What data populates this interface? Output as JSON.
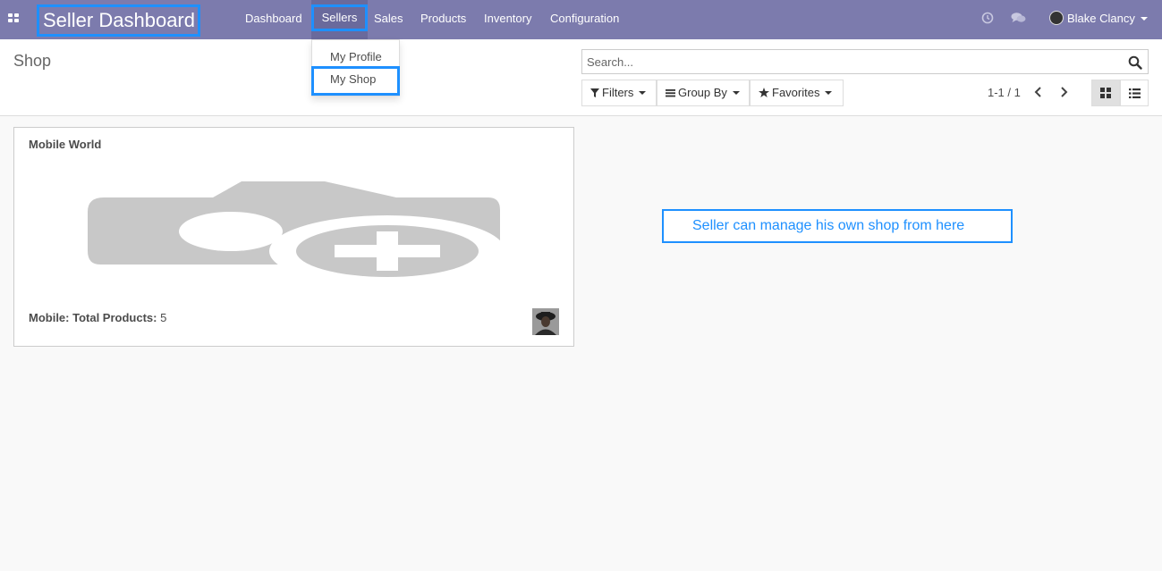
{
  "navbar": {
    "brand": "Seller Dashboard",
    "menu": [
      "Dashboard",
      "Sellers",
      "Sales",
      "Products",
      "Inventory",
      "Configuration"
    ],
    "active_menu": "Sellers",
    "user_name": "Blake Clancy",
    "icons": [
      "apps-icon",
      "clock-icon",
      "chat-icon",
      "user-avatar"
    ]
  },
  "dropdown": {
    "items": [
      "My Profile",
      "My Shop"
    ],
    "highlighted": "My Shop"
  },
  "control_panel": {
    "title": "Shop",
    "search_placeholder": "Search...",
    "filters_label": "Filters",
    "groupby_label": "Group By",
    "favorites_label": "Favorites",
    "pager": "1-1 / 1",
    "views": [
      "kanban",
      "list"
    ],
    "active_view": "kanban"
  },
  "records": [
    {
      "name": "Mobile World",
      "footer_label": "Mobile: Total Products:",
      "footer_value": "5"
    }
  ],
  "annotation": "Seller can manage his own shop from here",
  "colors": {
    "navbar": "#7c7bad",
    "highlight": "#1e90ff",
    "background": "#f9f9f9"
  }
}
